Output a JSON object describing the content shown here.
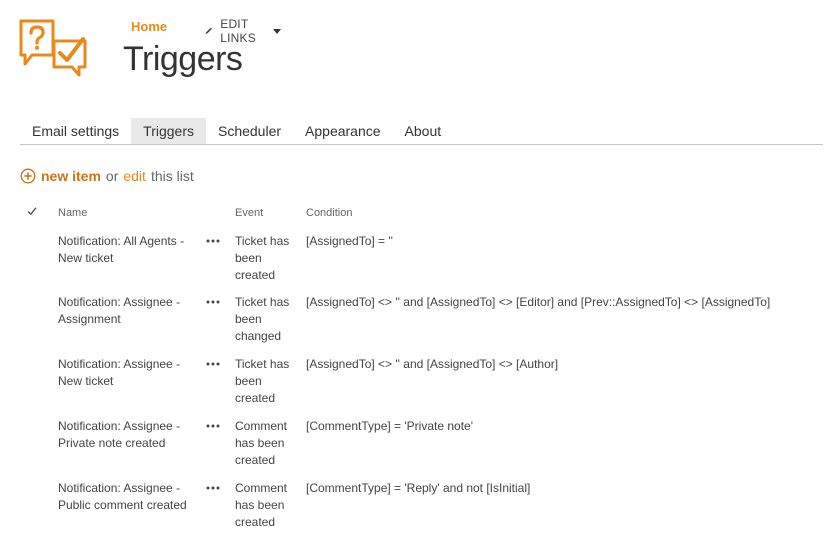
{
  "header": {
    "home_label": "Home",
    "edit_links_label": "EDIT LINKS",
    "title": "Triggers"
  },
  "tabs": [
    {
      "label": "Email settings",
      "active": false
    },
    {
      "label": "Triggers",
      "active": true
    },
    {
      "label": "Scheduler",
      "active": false
    },
    {
      "label": "Appearance",
      "active": false
    },
    {
      "label": "About",
      "active": false
    }
  ],
  "toolbar": {
    "new_item_label": "new item",
    "or_text": "or",
    "edit_label": "edit",
    "this_list_text": "this list"
  },
  "columns": {
    "name": "Name",
    "event": "Event",
    "condition": "Condition"
  },
  "rows": [
    {
      "name": "Notification: All Agents - New ticket",
      "event": "Ticket has been created",
      "condition": "[AssignedTo] = ''"
    },
    {
      "name": "Notification: Assignee - Assignment",
      "event": "Ticket has been changed",
      "condition": "[AssignedTo] <> '' and [AssignedTo] <> [Editor] and [Prev::AssignedTo] <> [AssignedTo]"
    },
    {
      "name": "Notification: Assignee - New ticket",
      "event": "Ticket has been created",
      "condition": "[AssignedTo] <> '' and [AssignedTo] <> [Author]"
    },
    {
      "name": "Notification: Assignee - Private note created",
      "event": "Comment has been created",
      "condition": "[CommentType] = 'Private note'"
    },
    {
      "name": "Notification: Assignee - Public comment created",
      "event": "Comment has been created",
      "condition": "[CommentType] = 'Reply' and not [IsInitial]"
    }
  ],
  "icons": {
    "logo": "question-check-chat-icon",
    "edit": "pencil-icon",
    "dropdown": "caret-down-icon",
    "add": "plus-circle-icon",
    "select_all": "checkmark-icon",
    "item_menu": "ellipsis-icon"
  },
  "colors": {
    "accent": "#e8891c",
    "accent_dark": "#c7741b",
    "text": "#444444",
    "tab_active_bg": "#e9e9e9"
  }
}
